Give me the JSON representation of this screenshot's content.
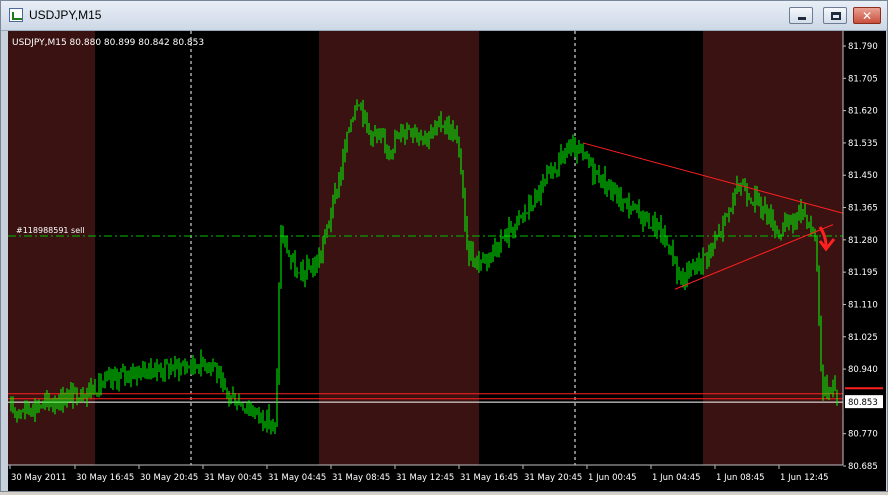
{
  "window": {
    "title": "USDJPY,M15"
  },
  "chart_data": {
    "type": "candlestick",
    "header": "USDJPY,M15  80.880 80.899 80.842 80.853",
    "symbol": "USDJPY",
    "timeframe": "M15",
    "ohlc": {
      "open": 80.88,
      "high": 80.899,
      "low": 80.842,
      "close": 80.853
    },
    "current_price": "80.853",
    "order_label": "#118988591 sell",
    "order_price": 81.29,
    "y_ticks": [
      "81.790",
      "81.705",
      "81.620",
      "81.535",
      "81.450",
      "81.365",
      "81.280",
      "81.195",
      "81.110",
      "81.025",
      "80.940",
      "80.853",
      "80.770",
      "80.685"
    ],
    "ylim": [
      80.685,
      81.79
    ],
    "x_ticks": [
      "30 May 2011",
      "30 May 16:45",
      "30 May 20:45",
      "31 May 00:45",
      "31 May 04:45",
      "31 May 08:45",
      "31 May 12:45",
      "31 May 16:45",
      "31 May 20:45",
      "1 Jun 00:45",
      "1 Jun 04:45",
      "1 Jun 08:45",
      "1 Jun 12:45"
    ],
    "session_shading": "dark-red",
    "candle_color": "#00ff00",
    "red_levels": [
      80.875,
      80.862
    ],
    "white_level": 80.853,
    "trendlines": [
      {
        "from": [
          "31 May 21:00",
          81.535
        ],
        "to": [
          "1 Jun 15:00",
          81.35
        ]
      },
      {
        "from": [
          "1 Jun 03:00",
          81.15
        ],
        "to": [
          "1 Jun 14:00",
          81.32
        ]
      }
    ],
    "arrow": "red-down-arrow"
  }
}
